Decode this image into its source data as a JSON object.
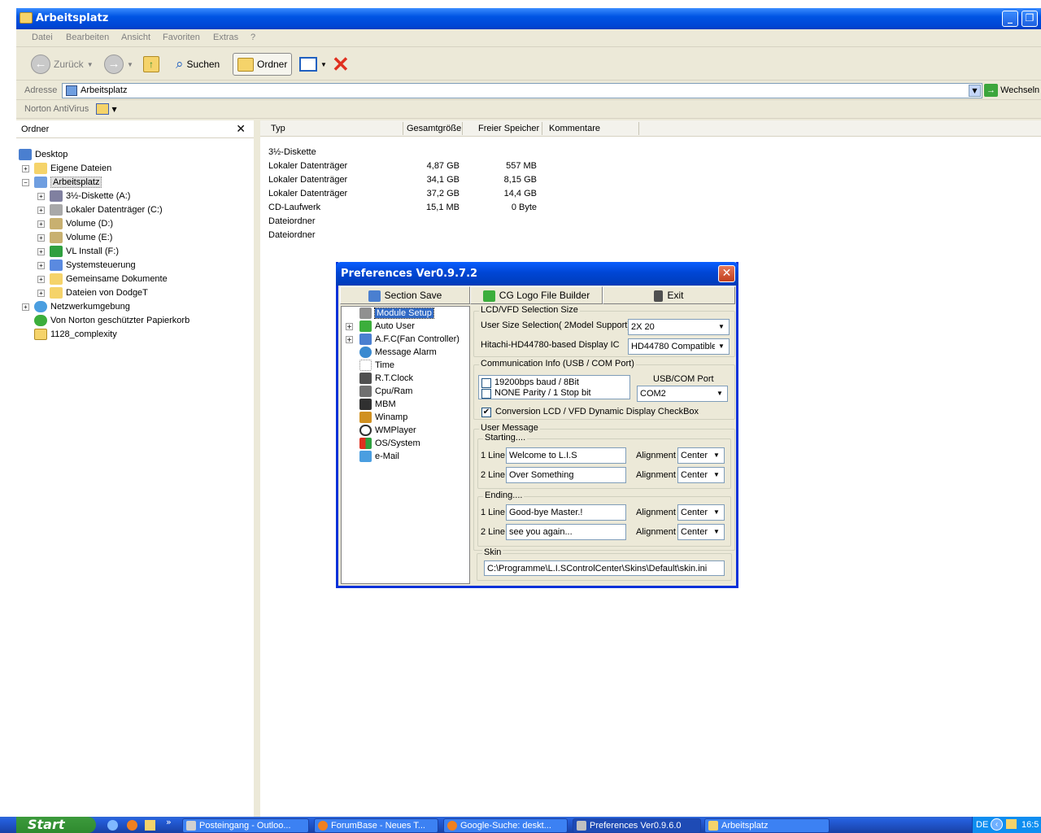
{
  "explorer": {
    "title": "Arbeitsplatz",
    "menu": [
      "Datei",
      "Bearbeiten",
      "Ansicht",
      "Favoriten",
      "Extras",
      "?"
    ],
    "toolbar": {
      "back": "Zurück",
      "search": "Suchen",
      "folders": "Ordner"
    },
    "address": {
      "label": "Adresse",
      "value": "Arbeitsplatz",
      "go": "Wechseln"
    },
    "norton": {
      "label": "Norton AntiVirus"
    },
    "folder_pane": {
      "header": "Ordner",
      "close": "✕",
      "items": [
        {
          "label": "Desktop"
        },
        {
          "label": "Eigene Dateien"
        },
        {
          "label": "Arbeitsplatz"
        },
        {
          "label": "3½-Diskette (A:)"
        },
        {
          "label": "Lokaler Datenträger (C:)"
        },
        {
          "label": "Volume (D:)"
        },
        {
          "label": "Volume (E:)"
        },
        {
          "label": "VL Install (F:)"
        },
        {
          "label": "Systemsteuerung"
        },
        {
          "label": "Gemeinsame Dokumente"
        },
        {
          "label": "Dateien von DodgeT"
        },
        {
          "label": "Netzwerkumgebung"
        },
        {
          "label": "Von Norton geschützter Papierkorb"
        },
        {
          "label": "1128_complexity"
        }
      ]
    },
    "list": {
      "columns": [
        "Typ",
        "Gesamtgröße",
        "Freier Speicher",
        "Kommentare"
      ],
      "rows": [
        {
          "type": "3½-Diskette",
          "total": "",
          "free": ""
        },
        {
          "type": "Lokaler Datenträger",
          "total": "4,87 GB",
          "free": "557 MB"
        },
        {
          "type": "Lokaler Datenträger",
          "total": "34,1 GB",
          "free": "8,15 GB"
        },
        {
          "type": "Lokaler Datenträger",
          "total": "37,2 GB",
          "free": "14,4 GB"
        },
        {
          "type": "CD-Laufwerk",
          "total": "15,1 MB",
          "free": "0 Byte"
        },
        {
          "type": "Dateiordner",
          "total": "",
          "free": ""
        },
        {
          "type": "Dateiordner",
          "total": "",
          "free": ""
        }
      ]
    }
  },
  "prefs": {
    "title": "Preferences Ver0.9.7.2",
    "tabs": {
      "save": "Section Save",
      "logo": "CG Logo File Builder",
      "exit": "Exit"
    },
    "modules": [
      "Module Setup",
      "Auto User",
      "A.F.C(Fan Controller)",
      "Message Alarm",
      "Time",
      "R.T.Clock",
      "Cpu/Ram",
      "MBM",
      "Winamp",
      "WMPlayer",
      "OS/System",
      "e-Mail"
    ],
    "lcd": {
      "group": "LCD/VFD Selection Size",
      "size_label": "User Size Selection( 2Model Support)",
      "size_value": "2X 20",
      "ic_label": "Hitachi-HD44780-based Display IC",
      "ic_value": "HD44780 Compatible"
    },
    "comm": {
      "group": "Communication Info (USB / COM Port)",
      "baud": "19200bps baud / 8Bit",
      "parity": "NONE Parity / 1 Stop bit",
      "port_label": "USB/COM Port",
      "port_value": "COM2",
      "conversion": "Conversion LCD / VFD Dynamic Display CheckBox"
    },
    "user_message": {
      "group": "User Message",
      "starting": "Starting....",
      "ending": "Ending....",
      "line1": "1 Line",
      "line2": "2 Line",
      "alignment": "Alignment",
      "start_line1": "Welcome to L.I.S",
      "start_line2": "Over Something",
      "end_line1": "Good-bye Master.!",
      "end_line2": "see you again...",
      "align_value": "Center"
    },
    "skin": {
      "group": "Skin",
      "path": "C:\\Programme\\L.I.SControlCenter\\Skins\\Default\\skin.ini"
    }
  },
  "taskbar": {
    "start": "Start",
    "tasks": [
      "Posteingang - Outloo...",
      "ForumBase - Neues T...",
      "Google-Suche: deskt...",
      "Preferences Ver0.9.6.0",
      "Arbeitsplatz"
    ],
    "lang": "DE",
    "clock": "16:5"
  }
}
